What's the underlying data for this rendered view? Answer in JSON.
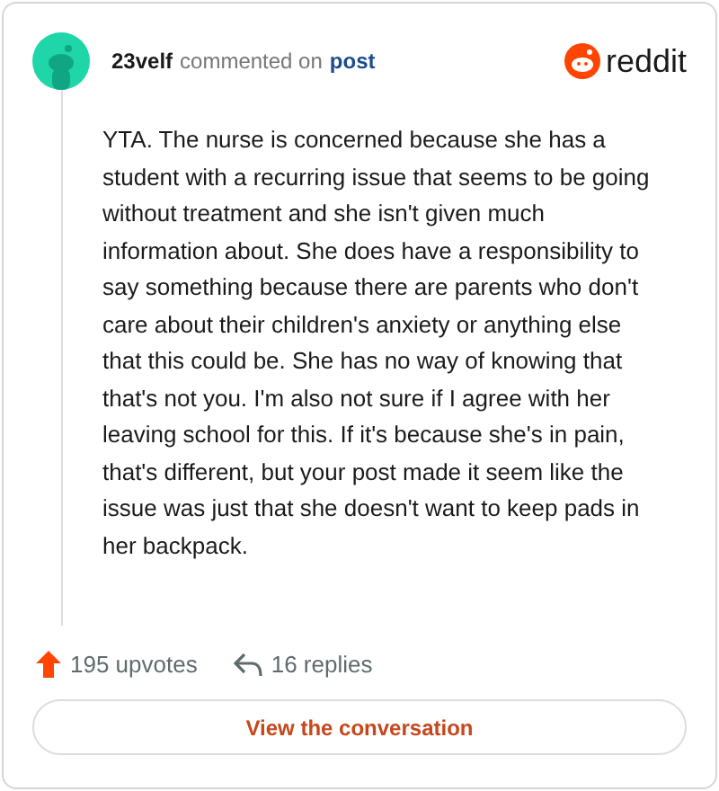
{
  "comment": {
    "author": "23velf",
    "action": "commented on",
    "link": "post",
    "body": "YTA. The nurse is concerned because she has a student with a recurring issue that seems to be going without treatment and she isn't given much information about. She does have a responsibility to say something because there are parents who don't care about their children's anxiety or anything else that this could be. She has no way of knowing that that's not you. I'm also not sure if I agree with her leaving school for this. If it's because she's in pain, that's different, but your post made it seem like the issue was just that she doesn't want to keep pads in her backpack."
  },
  "brand": {
    "name": "reddit"
  },
  "stats": {
    "upvotes": "195 upvotes",
    "replies": "16 replies"
  },
  "button": {
    "label": "View the conversation"
  }
}
